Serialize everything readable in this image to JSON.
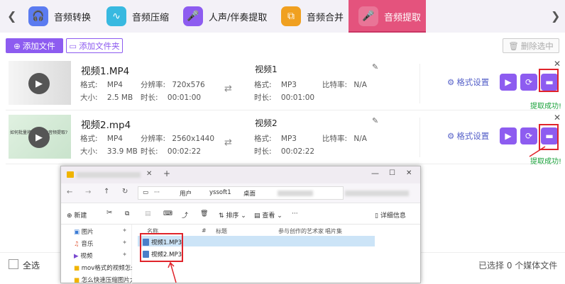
{
  "tabs": [
    {
      "label": "音频转换",
      "color": "#5b7bf0",
      "icon": "headphones-icon"
    },
    {
      "label": "音频压缩",
      "color": "#38b9e0",
      "icon": "waveform-icon"
    },
    {
      "label": "人声/伴奏提取",
      "color": "#8d5cf0",
      "icon": "microphone-icon"
    },
    {
      "label": "音频合并",
      "color": "#f0a020",
      "icon": "merge-icon"
    },
    {
      "label": "音频提取",
      "color": "#e4537d",
      "icon": "microphone-icon"
    }
  ],
  "toolbar": {
    "add_file": "添加文件",
    "add_folder": "添加文件夹",
    "delete_selected": "删除选中"
  },
  "files": [
    {
      "name": "视频1.MP4",
      "format_label": "格式:",
      "format": "MP4",
      "size_label": "大小:",
      "size": "2.5 MB",
      "resolution_label": "分辨率:",
      "resolution": "720x576",
      "duration_label": "时长:",
      "duration": "00:01:00",
      "output_name": "视频1",
      "output_format_label": "格式:",
      "output_format": "MP3",
      "bitrate_label": "比特率:",
      "bitrate": "N/A",
      "output_duration_label": "时长:",
      "output_duration": "00:01:00",
      "status": "提取成功!"
    },
    {
      "name": "视频2.mp4",
      "format_label": "格式:",
      "format": "MP4",
      "size_label": "大小:",
      "size": "33.9 MB",
      "resolution_label": "分辨率:",
      "resolution": "2560x1440",
      "duration_label": "时长:",
      "duration": "00:02:22",
      "output_name": "视频2",
      "output_format_label": "格式:",
      "output_format": "MP3",
      "bitrate_label": "比特率:",
      "bitrate": "N/A",
      "output_duration_label": "时长:",
      "output_duration": "00:02:22",
      "status": "提取成功!"
    }
  ],
  "thumb2_text": "如何批量将视频中的音频提取?",
  "format_settings": "格式设置",
  "footer": {
    "select_all": "全选",
    "selected_count": "已选择 0 个媒体文件"
  },
  "explorer": {
    "breadcrumb": [
      "用户",
      "yssoft1",
      "桌面"
    ],
    "cmd": {
      "new": "新建",
      "sort": "排序",
      "view": "查看",
      "details": "详细信息"
    },
    "nav_items": [
      {
        "label": "图片",
        "icon": "pictures-icon"
      },
      {
        "label": "音乐",
        "icon": "music-icon"
      },
      {
        "label": "视频",
        "icon": "videos-icon"
      },
      {
        "label": "mov格式的视频怎么",
        "icon": "folder-icon"
      },
      {
        "label": "怎么快速压缩图片大",
        "icon": "folder-icon"
      }
    ],
    "columns": [
      "名称",
      "#",
      "标题",
      "参与创作的艺术家",
      "唱片集"
    ],
    "files": [
      "视频1.MP3",
      "视频2.MP3"
    ]
  },
  "colors": {
    "accent": "#8d5cf0",
    "active_tab": "#e4537d",
    "success": "#1aa23b",
    "highlight": "#e0242b"
  }
}
